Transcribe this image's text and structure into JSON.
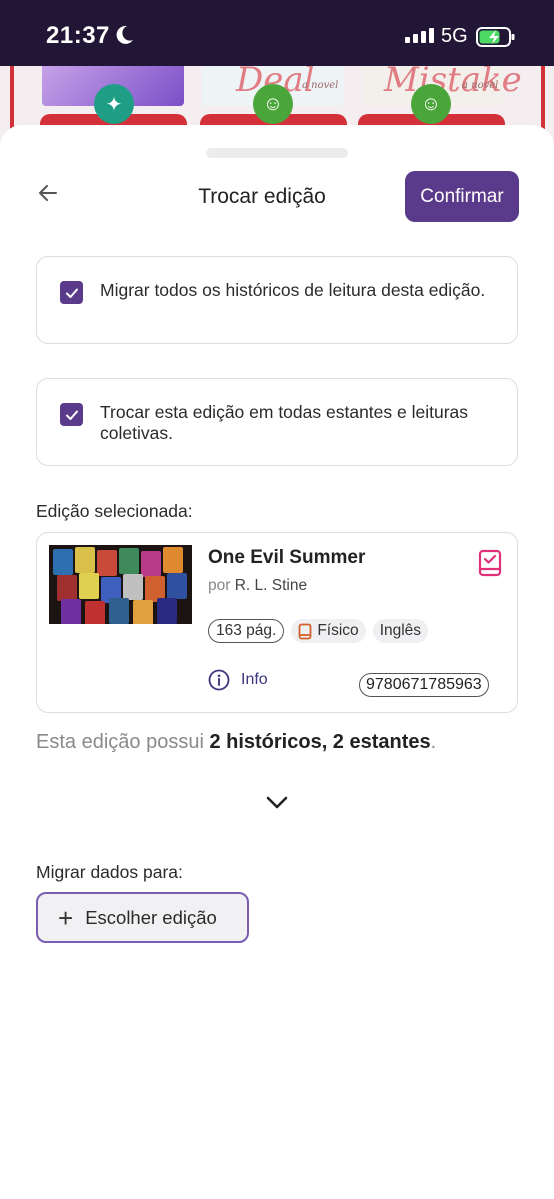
{
  "status_bar": {
    "time": "21:37",
    "network": "5G"
  },
  "header": {
    "title": "Trocar edição",
    "confirm_label": "Confirmar"
  },
  "options": [
    {
      "label": "Migrar todos os históricos de leitura desta edição.",
      "checked": true
    },
    {
      "label": "Trocar esta edição em todas estantes e leituras coletivas.",
      "checked": true
    }
  ],
  "selected_section": {
    "label": "Edição selecionada:"
  },
  "book": {
    "title": "One Evil Summer",
    "author_prefix": "por",
    "author": "R. L. Stine",
    "pages": "163 pág.",
    "format": "Físico",
    "language": "Inglês",
    "info_label": "Info",
    "isbn": "9780671785963"
  },
  "summary": {
    "prefix": "Esta edição possui ",
    "bold": "2 históricos, 2 estantes",
    "suffix": "."
  },
  "migrate_section": {
    "label": "Migrar dados para:",
    "button_label": "Escolher edição"
  },
  "background_covers": [
    {
      "text": ""
    },
    {
      "text": "Deal",
      "sub": "a novel"
    },
    {
      "text": "Mistake",
      "sub": "a novel"
    }
  ],
  "colors": {
    "primary": "#5a3a8a",
    "accent_pink": "#e0307a",
    "badge_green": "#4aa63a",
    "badge_teal": "#1f9e86"
  }
}
